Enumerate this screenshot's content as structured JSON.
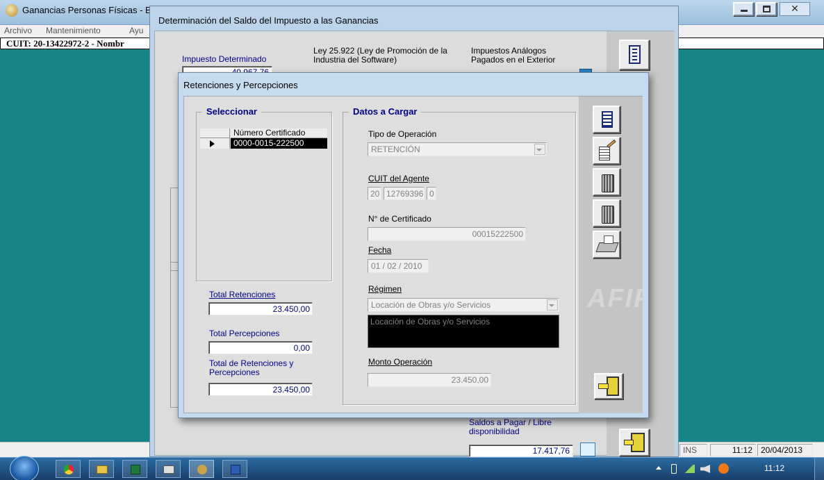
{
  "main_window": {
    "title": "Ganancias Personas Físicas - B",
    "menu": [
      "Archivo",
      "Mantenimiento",
      "Ayu"
    ],
    "cuit_bar": "CUIT: 20-13422972-2 - Nombr"
  },
  "saldo_dialog": {
    "title": "Determinación del Saldo del Impuesto a las Ganancias",
    "impuesto_determinado_label": "Impuesto Determinado",
    "impuesto_determinado_value": "40.967,76",
    "ley_label": "Ley 25.922 (Ley de Promoción de la Industria del Software)",
    "impuestos_analogos_label": "Impuestos Análogos Pagados en el Exterior",
    "saldos_label": "Saldos a Pagar / Libre disponibilidad",
    "saldos_value": "17.417,76"
  },
  "retenciones_dialog": {
    "title": "Retenciones y Percepciones",
    "seleccionar": {
      "title": "Seleccionar",
      "column_header": "Número Certificado",
      "rows": [
        "0000-0015-222500"
      ]
    },
    "totals": {
      "retenciones_label": "Total Retenciones",
      "retenciones_value": "23.450,00",
      "percepciones_label": "Total Percepciones",
      "percepciones_value": "0,00",
      "total_label": "Total de Retenciones y Percepciones",
      "total_value": "23.450,00"
    },
    "datos": {
      "title": "Datos a Cargar",
      "tipo_operacion_label": "Tipo de Operación",
      "tipo_operacion_value": "RETENCIÓN",
      "cuit_agente_label": "CUIT del Agente",
      "cuit_1": "20",
      "cuit_2": "12769396",
      "cuit_3": "0",
      "certificado_label": "N° de Certificado",
      "certificado_value": "00015222500",
      "fecha_label": "Fecha",
      "fecha_value": "01 / 02 / 2010",
      "regimen_label": "Régimen",
      "regimen_value": "Locación de Obras y/o Servicios",
      "regimen_desc": "Locación de Obras y/o Servicios",
      "monto_label": "Monto Operación",
      "monto_value": "23.450,00"
    },
    "watermark": "AFIP"
  },
  "status_bar": {
    "ins": "INS",
    "time": "11:12",
    "date": "20/04/2013"
  },
  "taskbar": {
    "clock": "11:12"
  }
}
